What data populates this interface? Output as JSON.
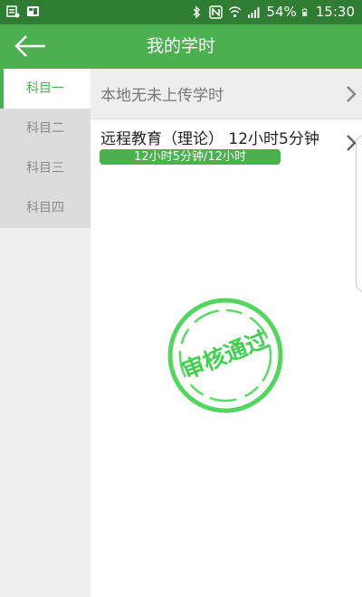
{
  "status_bar": {
    "battery": "54%",
    "time": "15:30",
    "colors": {
      "bg": "#2f7d32"
    }
  },
  "app_bar": {
    "title": "我的学时",
    "back_icon": "arrow-left-icon",
    "colors": {
      "bg": "#4caf50"
    }
  },
  "sidebar": {
    "tabs": [
      {
        "label": "科目一",
        "active": true
      },
      {
        "label": "科目二",
        "active": false
      },
      {
        "label": "科目三",
        "active": false
      },
      {
        "label": "科目四",
        "active": false
      }
    ],
    "colors": {
      "active": "#4caf50",
      "inactive_bg": "#dcdcdc"
    }
  },
  "content": {
    "local_row": {
      "label": "本地无未上传学时",
      "icon": "chevron-right-icon"
    },
    "remote_row": {
      "label": "远程教育（理论）   12小时5分钟",
      "progress_text": "12小时5分钟/12小时",
      "progress": 1.0,
      "icon": "chevron-right-icon"
    },
    "stamp": {
      "text": "审核通过",
      "color": "#3fd24e"
    }
  }
}
